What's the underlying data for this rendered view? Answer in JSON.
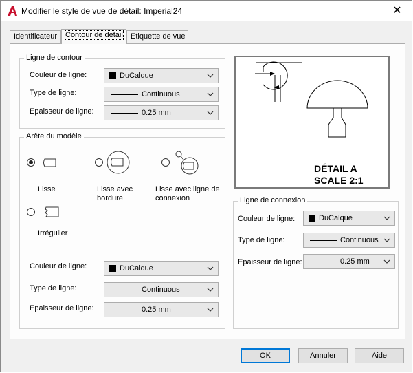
{
  "window": {
    "title": "Modifier le style de vue de détail: Imperial24",
    "close_symbol": "✕"
  },
  "tabs": [
    {
      "label": "Identificateur",
      "active": false
    },
    {
      "label": "Contour de détail",
      "active": true
    },
    {
      "label": "Etiquette de vue",
      "active": false
    }
  ],
  "contour_group": {
    "title": "Ligne de contour",
    "color": {
      "label": "Couleur de ligne:",
      "value": "DuCalque"
    },
    "linetype": {
      "label": "Type de ligne:",
      "value": "Continuous"
    },
    "lineweight": {
      "label": "Epaisseur de ligne:",
      "value": "0.25 mm"
    }
  },
  "model_edge_group": {
    "title": "Arête du modèle",
    "options": [
      {
        "label": "Lisse",
        "selected": true
      },
      {
        "label": "Lisse avec bordure",
        "selected": false
      },
      {
        "label": "Lisse avec ligne de connexion",
        "selected": false
      },
      {
        "label": "Irrégulier",
        "selected": false
      }
    ],
    "color": {
      "label": "Couleur de ligne:",
      "value": "DuCalque"
    },
    "linetype": {
      "label": "Type de ligne:",
      "value": "Continuous"
    },
    "lineweight": {
      "label": "Epaisseur de ligne:",
      "value": "0.25 mm"
    }
  },
  "preview": {
    "line1": "DÉTAIL A",
    "line2": "SCALE 2:1"
  },
  "connection_group": {
    "title": "Ligne de connexion",
    "color": {
      "label": "Couleur de ligne:",
      "value": "DuCalque"
    },
    "linetype": {
      "label": "Type de ligne:",
      "value": "Continuous"
    },
    "lineweight": {
      "label": "Epaisseur de ligne:",
      "value": "0.25 mm"
    }
  },
  "buttons": {
    "ok": "OK",
    "cancel": "Annuler",
    "help": "Aide"
  },
  "colors": {
    "accent": "#0078d7",
    "app_icon": "#c8102e"
  }
}
